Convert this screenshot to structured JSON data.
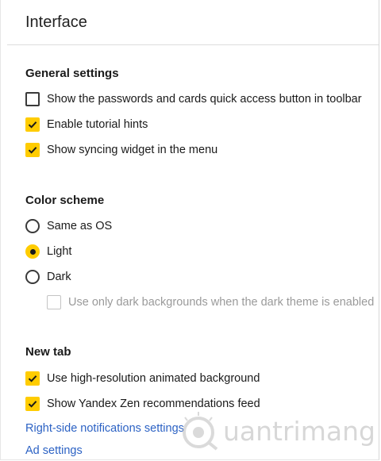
{
  "page": {
    "title": "Interface"
  },
  "general_settings": {
    "heading": "General settings",
    "options": [
      {
        "label": "Show the passwords and cards quick access button in toolbar",
        "checked": false
      },
      {
        "label": "Enable tutorial hints",
        "checked": true
      },
      {
        "label": "Show syncing widget in the menu",
        "checked": true
      }
    ]
  },
  "color_scheme": {
    "heading": "Color scheme",
    "options": [
      {
        "label": "Same as OS",
        "selected": false
      },
      {
        "label": "Light",
        "selected": true
      },
      {
        "label": "Dark",
        "selected": false
      }
    ],
    "dark_backgrounds": {
      "label": "Use only dark backgrounds when the dark theme is enabled",
      "checked": false,
      "disabled": true
    }
  },
  "new_tab": {
    "heading": "New tab",
    "options": [
      {
        "label": "Use high-resolution animated background",
        "checked": true
      },
      {
        "label": "Show Yandex Zen recommendations feed",
        "checked": true
      }
    ]
  },
  "links": {
    "notifications": "Right-side notifications settings",
    "ads": "Ad settings"
  },
  "watermark": {
    "text": "uantrimang"
  },
  "colors": {
    "accent": "#ffcc00",
    "link": "#2c62c4"
  }
}
